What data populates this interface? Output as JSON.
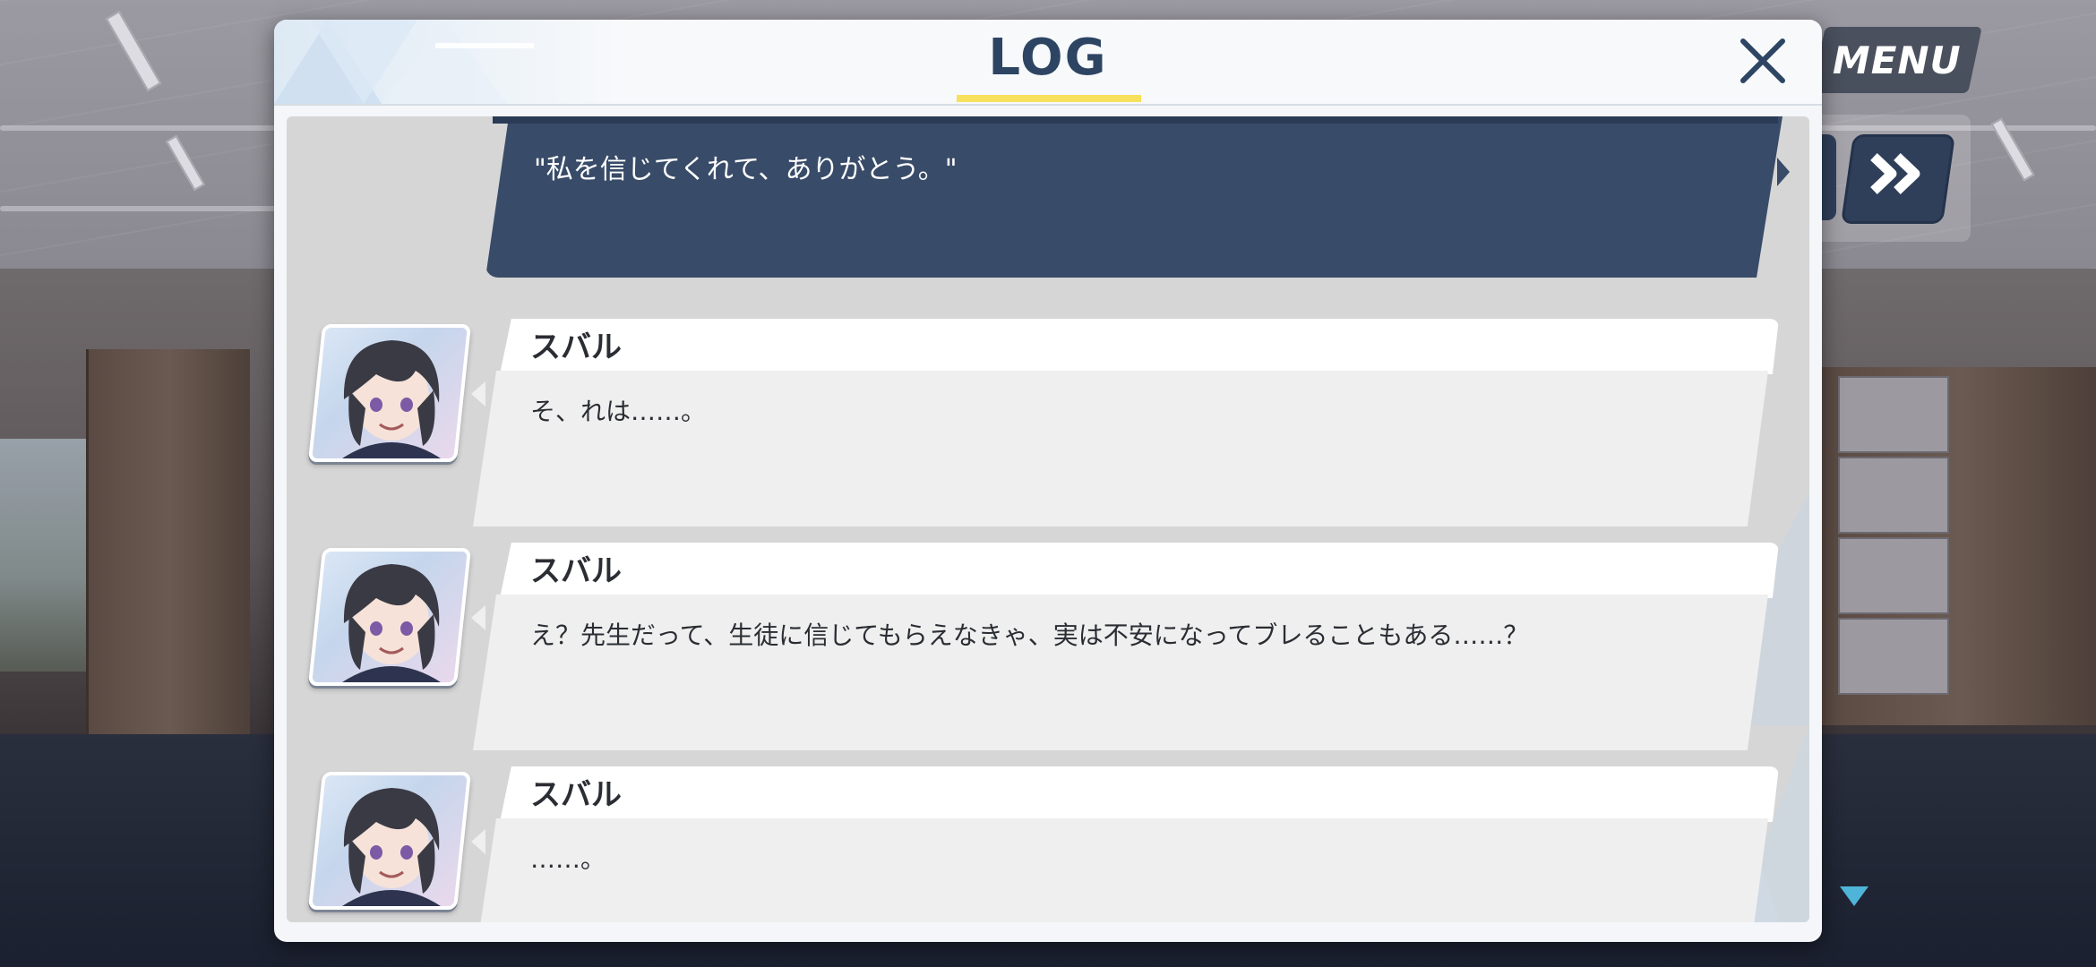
{
  "hud": {
    "menu_label": "MENU",
    "skip_icon": "double-chevron-right-icon",
    "scroll_icon": "triangle-down-icon"
  },
  "log": {
    "title": "LOG",
    "close_icon": "close-icon",
    "player_line": "\"私を信じてくれて、ありがとう。\"",
    "entries": [
      {
        "speaker": "スバル",
        "text": "そ、れは……。"
      },
      {
        "speaker": "スバル",
        "text": "え？先生だって、生徒に信じてもらえなきゃ、実は不安になってブレることもある……？"
      },
      {
        "speaker": "スバル",
        "text": "……。"
      }
    ]
  },
  "colors": {
    "title_text": "#2d4563",
    "title_underline": "#f6e05c",
    "player_bubble": "#384b68",
    "message_bg": "#efefef",
    "name_plate_bg": "#ffffff",
    "hud_button": "#2f3f5a"
  }
}
